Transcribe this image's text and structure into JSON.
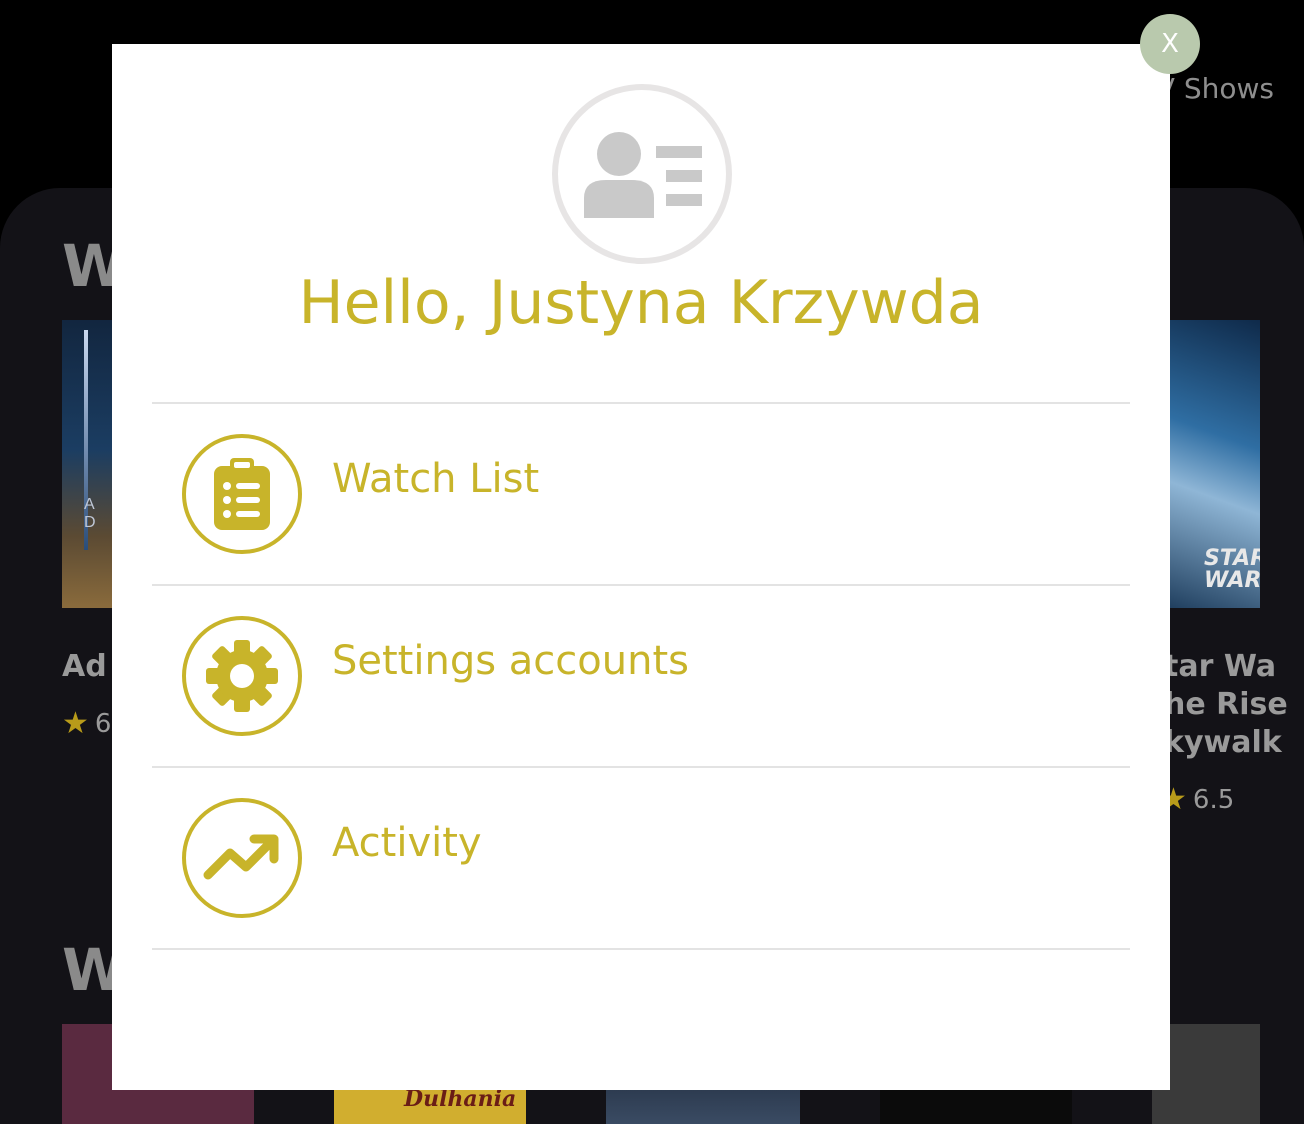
{
  "background": {
    "nav_link": "V Shows",
    "section_heading_1": "W",
    "section_heading_2": "W",
    "left_poster_letters": "A D",
    "right_poster_text": "STAR WAR",
    "left_card": {
      "title": "Ad A",
      "rating": "6"
    },
    "right_card": {
      "title_lines": [
        "tar Wa",
        "he Rise",
        "kywalk"
      ],
      "rating": "6.5"
    },
    "bottom_thumb_text": "Dulhania"
  },
  "modal": {
    "close_label": "X",
    "greeting": "Hello, Justyna Krzywda",
    "menu": [
      {
        "label": "Watch List",
        "icon": "clipboard-list-icon"
      },
      {
        "label": "Settings accounts",
        "icon": "gear-icon"
      },
      {
        "label": "Activity",
        "icon": "trending-up-icon"
      }
    ]
  },
  "colors": {
    "accent": "#c8b42a",
    "close_button": "#b9c9ad",
    "avatar_gray": "#c9c9c9",
    "divider": "#e3e3e3"
  }
}
